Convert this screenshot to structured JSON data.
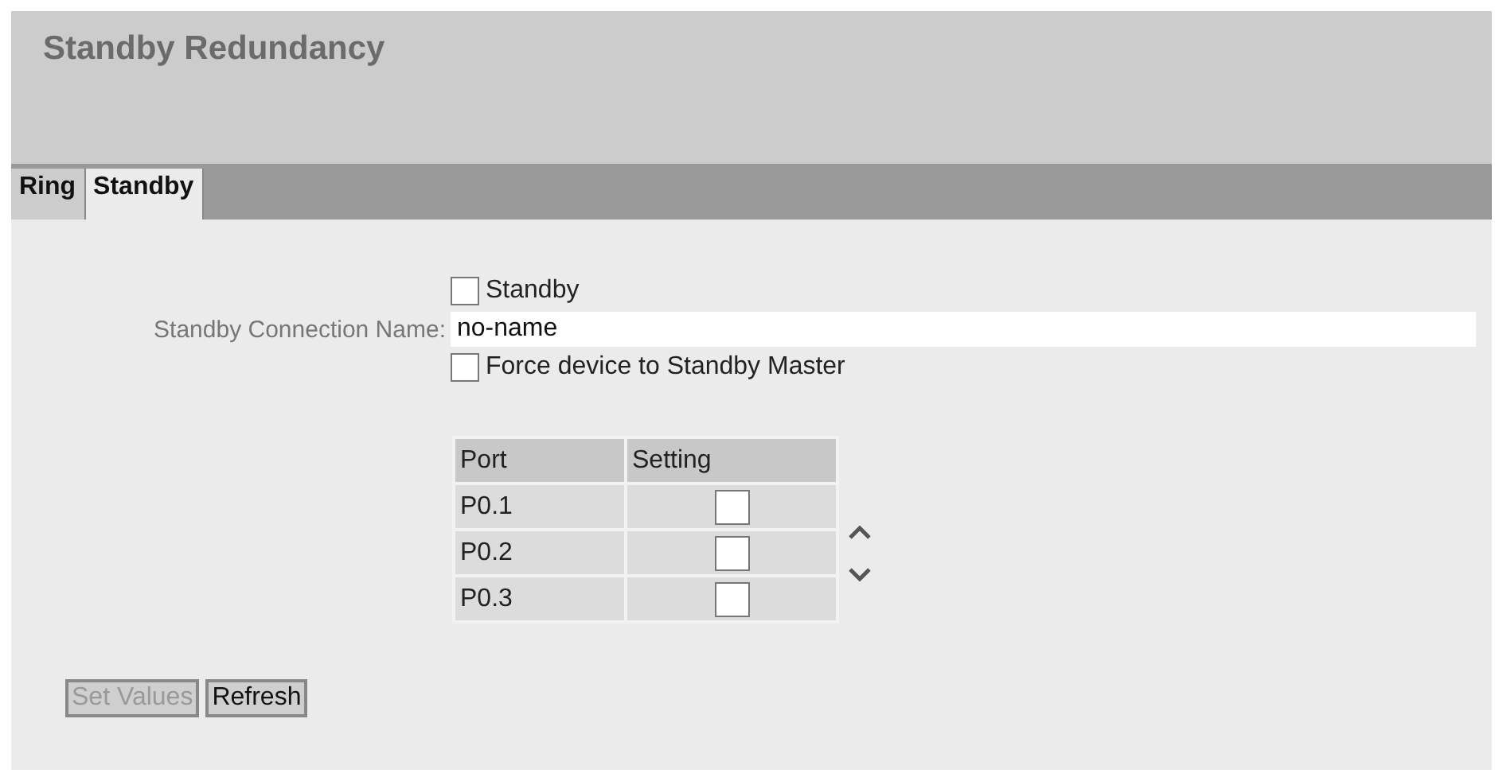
{
  "page": {
    "title": "Standby Redundancy"
  },
  "tabs": [
    {
      "label": "Ring",
      "selected": false
    },
    {
      "label": "Standby",
      "selected": true
    }
  ],
  "form": {
    "standby": {
      "label": "Standby",
      "checked": false
    },
    "connection_name": {
      "label": "Standby Connection Name:",
      "value": "no-name"
    },
    "force_master": {
      "label": "Force device to Standby Master",
      "checked": false
    }
  },
  "table": {
    "columns": [
      "Port",
      "Setting"
    ],
    "rows": [
      {
        "port": "P0.1",
        "checked": false
      },
      {
        "port": "P0.2",
        "checked": false
      },
      {
        "port": "P0.3",
        "checked": false
      }
    ]
  },
  "buttons": [
    {
      "label": "Set Values",
      "disabled": true
    },
    {
      "label": "Refresh",
      "disabled": false
    }
  ]
}
